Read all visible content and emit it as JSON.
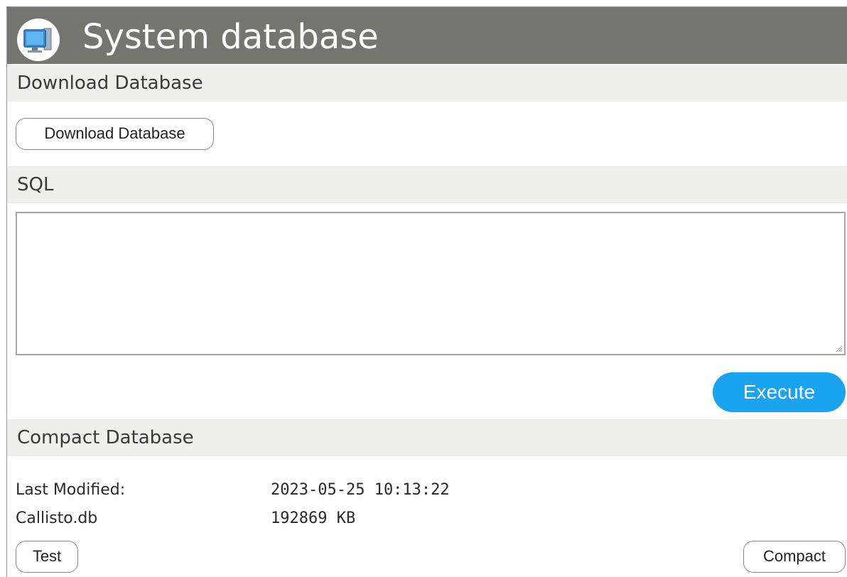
{
  "header": {
    "title": "System database",
    "icon": "computer-icon"
  },
  "download_section": {
    "heading": "Download Database",
    "button_label": "Download Database"
  },
  "sql_section": {
    "heading": "SQL",
    "query_value": "",
    "execute_label": "Execute"
  },
  "compact_section": {
    "heading": "Compact Database",
    "rows": [
      {
        "label": "Last Modified:",
        "value": "2023-05-25 10:13:22"
      },
      {
        "label": "Callisto.db",
        "value": "192869 KB"
      }
    ],
    "test_label": "Test",
    "compact_label": "Compact"
  },
  "colors": {
    "header_bg": "#757570",
    "section_bg": "#efefee",
    "primary": "#1aa3ee"
  }
}
